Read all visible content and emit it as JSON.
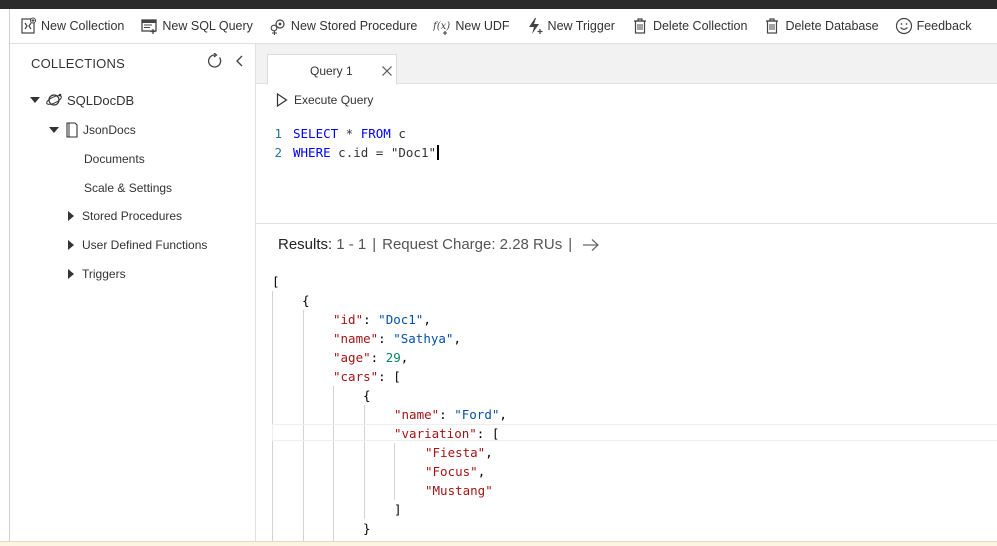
{
  "toolbar": {
    "items": [
      {
        "label": "New Collection",
        "icon": "new-collection-icon"
      },
      {
        "label": "New SQL Query",
        "icon": "new-sql-query-icon"
      },
      {
        "label": "New Stored Procedure",
        "icon": "new-stored-procedure-icon"
      },
      {
        "label": "New UDF",
        "icon": "new-udf-icon"
      },
      {
        "label": "New Trigger",
        "icon": "new-trigger-icon"
      },
      {
        "label": "Delete Collection",
        "icon": "trash-icon"
      },
      {
        "label": "Delete Database",
        "icon": "trash-icon"
      },
      {
        "label": "Feedback",
        "icon": "smiley-icon"
      }
    ]
  },
  "sidebar": {
    "header": "COLLECTIONS",
    "database": "SQLDocDB",
    "collection": "JsonDocs",
    "items": {
      "documents": "Documents",
      "scale": "Scale & Settings",
      "stored_procedures": "Stored Procedures",
      "udfs": "User Defined Functions",
      "triggers": "Triggers"
    }
  },
  "tab": {
    "label": "Query 1"
  },
  "execute": {
    "label": "Execute Query"
  },
  "editor": {
    "line1": {
      "num": "1",
      "kw1": "SELECT",
      "rest1": " * ",
      "kw2": "FROM",
      "rest2": " c"
    },
    "line2": {
      "num": "2",
      "kw1": "WHERE",
      "rest1": " c.id = ",
      "str": "\"Doc1\""
    }
  },
  "results": {
    "label": "Results:",
    "range": "1 - 1",
    "separator": "|",
    "charge": "Request Charge: 2.28 RUs"
  },
  "json_lines": {
    "l0": "[",
    "l1": "{",
    "id_key": "\"id\"",
    "id_val": "\"Doc1\"",
    "name_key": "\"name\"",
    "name_val": "\"Sathya\"",
    "age_key": "\"age\"",
    "age_val": "29",
    "cars_key": "\"cars\"",
    "car_name_key": "\"name\"",
    "car_name_val": "\"Ford\"",
    "variation_key": "\"variation\"",
    "v1": "\"Fiesta\"",
    "v2": "\"Focus\"",
    "v3": "\"Mustang\"",
    "arr_close": "]",
    "obj_close": "}"
  }
}
